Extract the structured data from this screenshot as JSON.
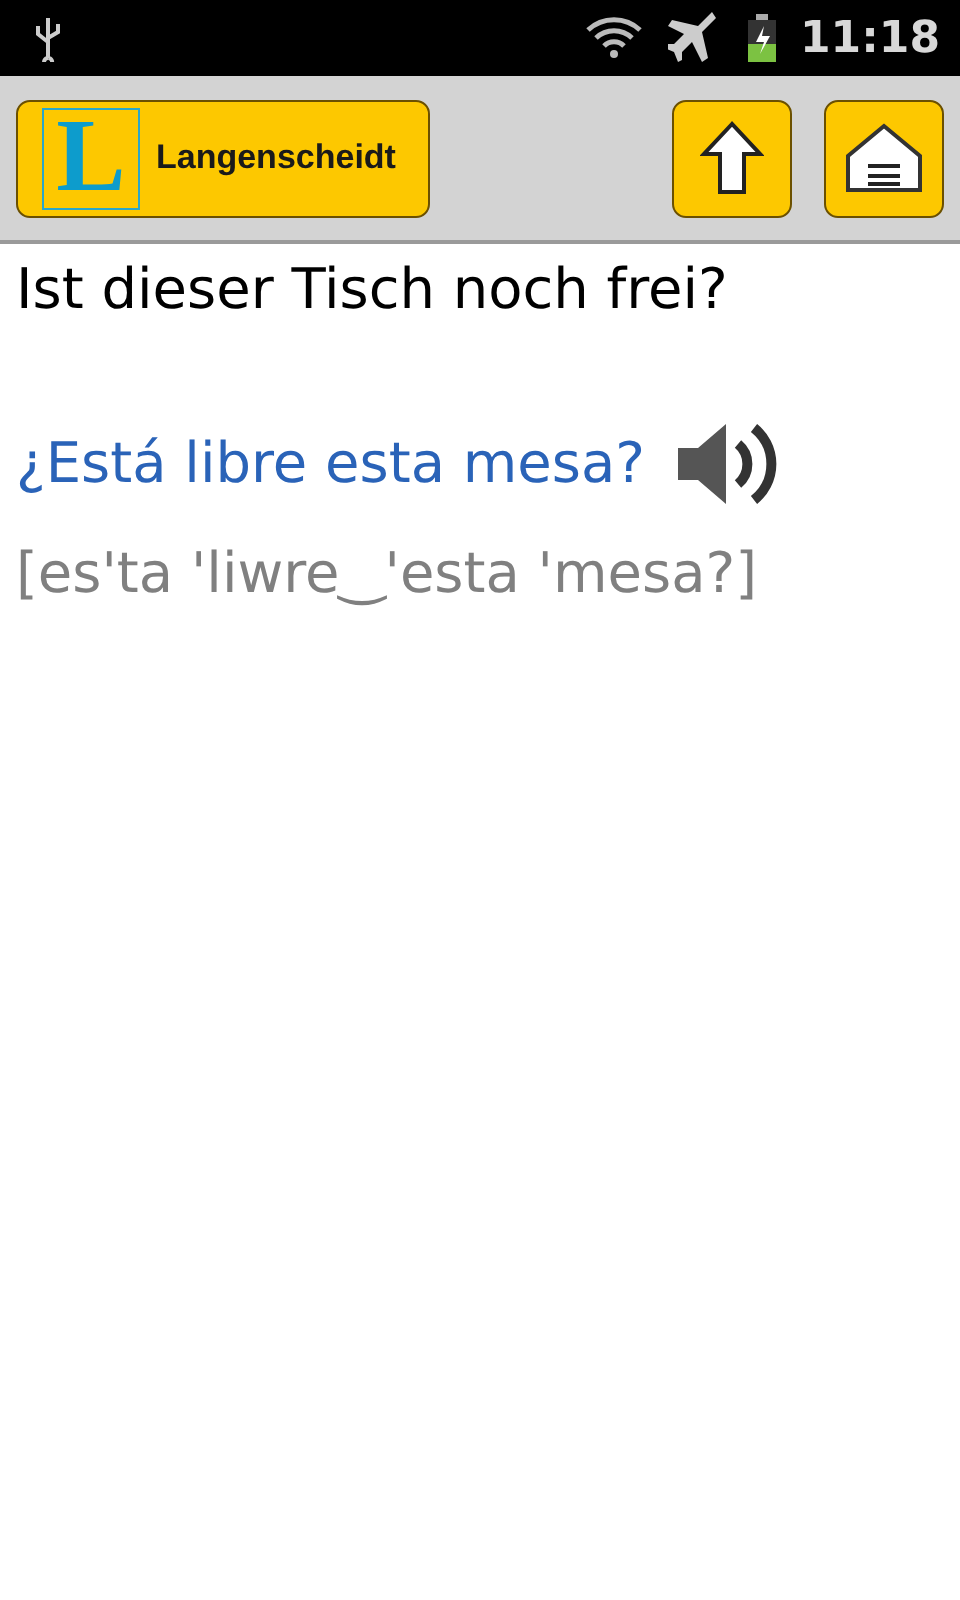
{
  "status_bar": {
    "time": "11:18"
  },
  "toolbar": {
    "logo": {
      "letter": "L",
      "name": "Langenscheidt"
    }
  },
  "phrase": {
    "source": "Ist dieser Tisch noch frei?",
    "translation": "¿Está libre esta mesa?",
    "pronunciation": "[es'ta 'liwre‿'esta 'mesa?]"
  }
}
